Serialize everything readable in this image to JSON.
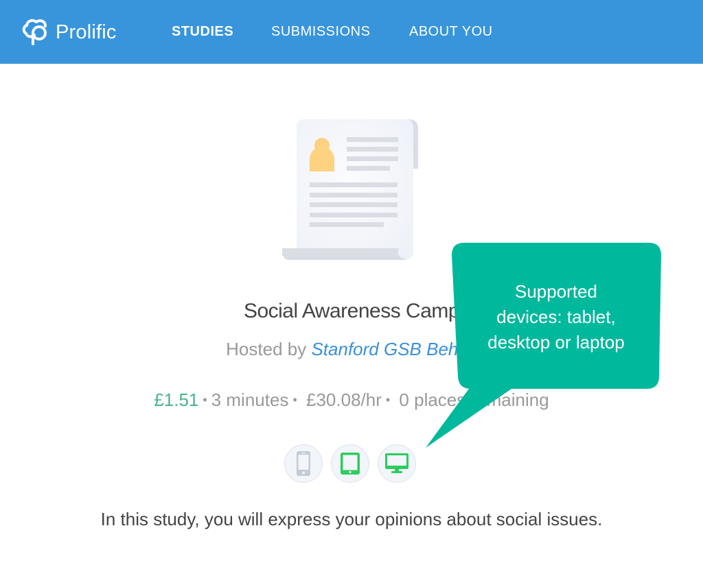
{
  "header": {
    "brand": "Prolific",
    "nav": [
      {
        "label": "STUDIES",
        "active": true
      },
      {
        "label": "SUBMISSIONS",
        "active": false
      },
      {
        "label": "ABOUT YOU",
        "active": false
      }
    ],
    "color": "#3895db"
  },
  "study": {
    "title": "Social Awareness Camp",
    "hosted_prefix": "Hosted by",
    "host": "Stanford GSB Behav",
    "reward": "£1.51",
    "duration": "3 minutes",
    "hourly_rate": "£30.08/hr",
    "places_remaining": "0 places remaining",
    "places_visible_left": "0 pla",
    "places_visible_right": "remaining",
    "separator": "•",
    "devices": [
      {
        "name": "mobile",
        "icon": "phone-icon",
        "supported": false
      },
      {
        "name": "tablet",
        "icon": "tablet-icon",
        "supported": true
      },
      {
        "name": "desktop",
        "icon": "desktop-icon",
        "supported": true
      }
    ],
    "description": "In this study, you will express your opinions about social issues."
  },
  "callout": {
    "text_lines": [
      "Supported",
      "devices: tablet,",
      "desktop or laptop"
    ],
    "color": "#00b89c"
  }
}
